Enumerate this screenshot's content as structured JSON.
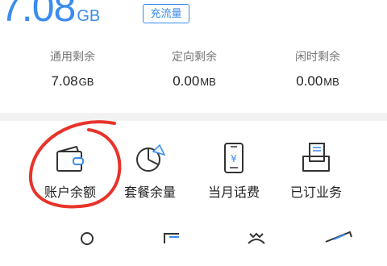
{
  "summary": {
    "total_value": "7.08",
    "total_unit": "GB",
    "recharge_label": "充流量"
  },
  "stats": [
    {
      "label": "通用剩余",
      "value": "7.08",
      "unit": "GB"
    },
    {
      "label": "定向剩余",
      "value": "0.00",
      "unit": "MB"
    },
    {
      "label": "闲时剩余",
      "value": "0.00",
      "unit": "MB"
    }
  ],
  "services": [
    {
      "label": "账户余额",
      "icon": "wallet-icon"
    },
    {
      "label": "套餐余量",
      "icon": "pie-chart-icon"
    },
    {
      "label": "当月话费",
      "icon": "phone-bill-icon"
    },
    {
      "label": "已订业务",
      "icon": "subscribed-services-icon"
    }
  ],
  "second_row_icons": [
    "user-icon",
    "card-icon",
    "money-bag-icon",
    "ticket-icon"
  ],
  "colors": {
    "accent": "#3b8ced",
    "annotation": "#e8332a",
    "text": "#222222",
    "muted": "#777777"
  }
}
